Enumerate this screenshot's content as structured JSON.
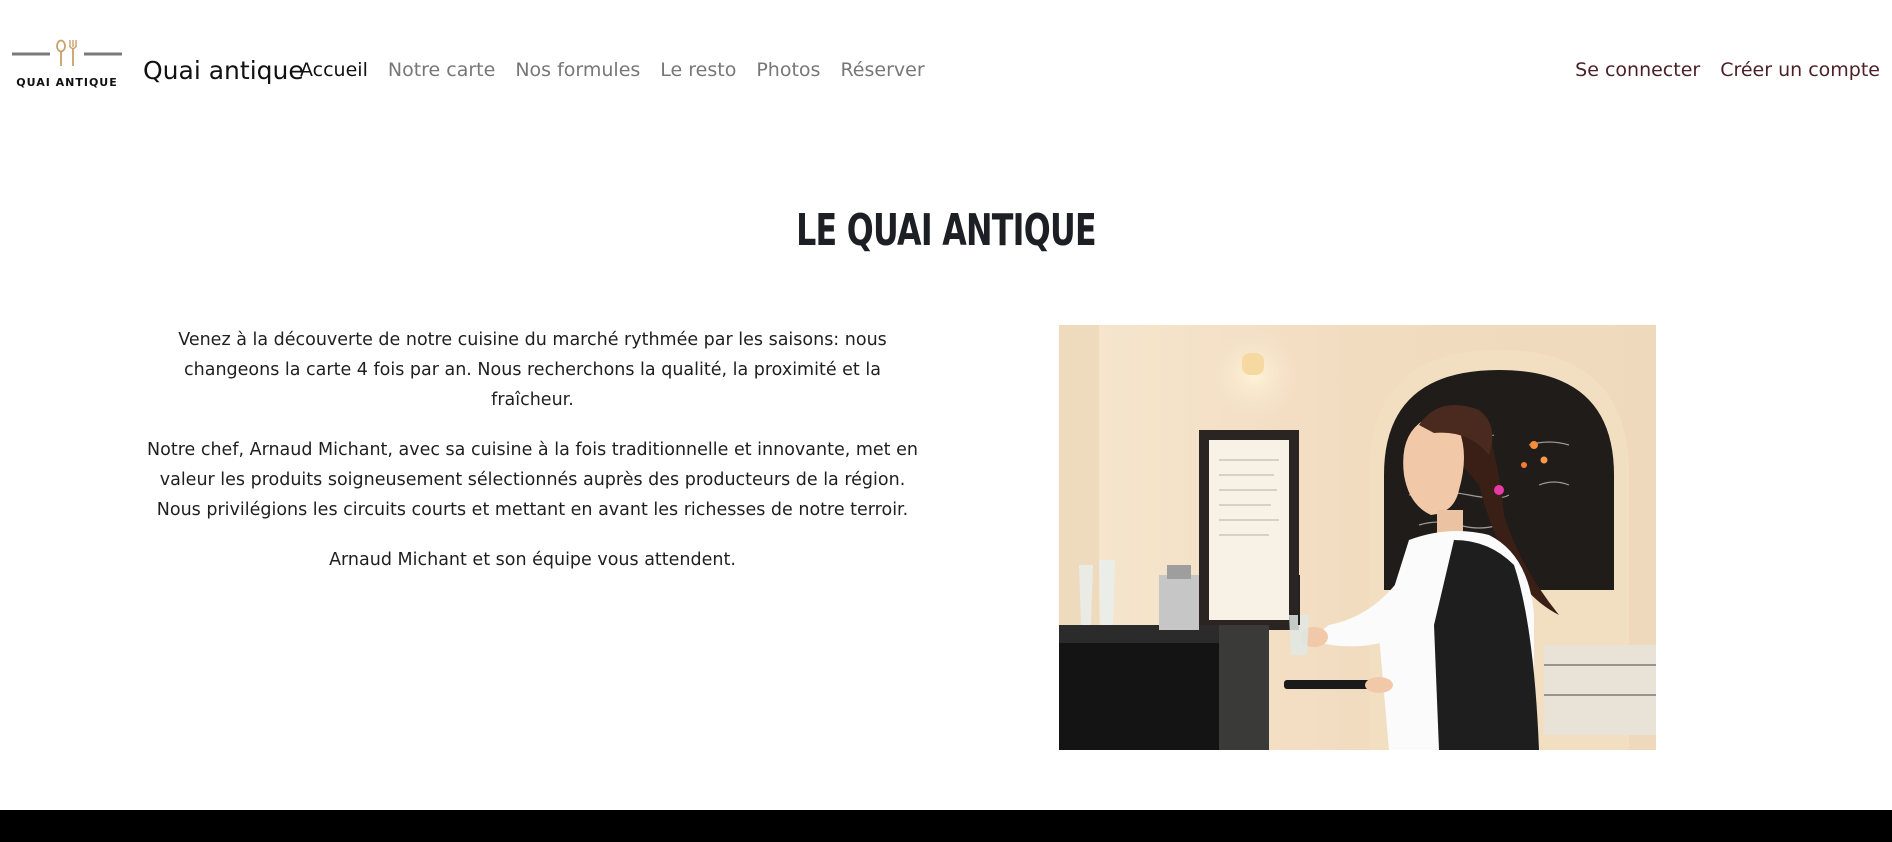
{
  "brand": {
    "logo_text": "QUAI ANTIQUE",
    "name": "Quai antique"
  },
  "nav": {
    "links": [
      {
        "label": "Accueil",
        "active": true
      },
      {
        "label": "Notre carte",
        "active": false
      },
      {
        "label": "Nos formules",
        "active": false
      },
      {
        "label": "Le resto",
        "active": false
      },
      {
        "label": "Photos",
        "active": false
      },
      {
        "label": "Réserver",
        "active": false
      }
    ],
    "right": [
      {
        "label": "Se connecter"
      },
      {
        "label": "Créer un compte"
      }
    ]
  },
  "main": {
    "title": "LE QUAI ANTIQUE",
    "paragraphs": [
      "Venez à la découverte de notre cuisine du marché rythmée par les saisons: nous changeons la carte 4 fois par an. Nous recherchons la qualité, la proximité et la fraîcheur.",
      "Notre chef, Arnaud Michant, avec sa cuisine à la fois traditionnelle et innovante, met en valeur les produits soigneusement sélectionnés auprès des producteurs de la région. Nous privilégions les circuits courts et mettant en avant les richesses de notre terroir.",
      "Arnaud Michant et son équipe vous attendent."
    ]
  },
  "colors": {
    "accent_dark": "#4a1f26",
    "logo_gold": "#c9a06a",
    "nav_inactive": "#777777",
    "footer": "#000000"
  }
}
